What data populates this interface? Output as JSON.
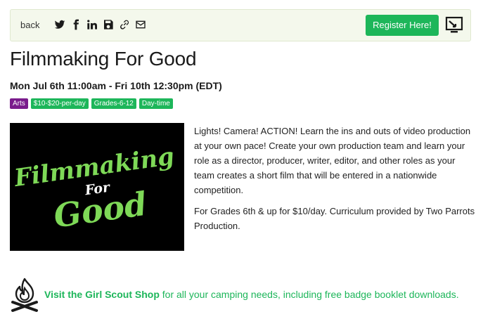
{
  "toolbar": {
    "back_label": "back",
    "share_icons": [
      "twitter-icon",
      "facebook-icon",
      "linkedin-icon",
      "save-icon",
      "link-icon",
      "email-icon"
    ],
    "register_label": "Register Here!"
  },
  "event": {
    "title": "Filmmaking For Good",
    "dates": "Mon Jul 6th 11:00am - Fri 10th 12:30pm (EDT)",
    "tags": [
      "Arts",
      "$10-$20-per-day",
      "Grades-6-12",
      "Day-time"
    ],
    "image_text": [
      "Filmmaking",
      "For",
      "Good"
    ],
    "description": [
      "Lights! Camera! ACTION! Learn the ins and outs of video production at your own pace! Create your own production team and learn your role as a director, producer, writer, editor, and other roles as your team creates a short film that will be entered in a nationwide competition.",
      "For Grades 6th & up for $10/day. Curriculum provided by Two Parrots Production."
    ]
  },
  "footer": {
    "link_text": "Visit the Girl Scout Shop",
    "rest_text": " for all your camping needs, including free badge booklet downloads."
  },
  "colors": {
    "accent_green": "#1db65a",
    "arts_purple": "#7a1b8c",
    "toolbar_bg": "#f4f8ec",
    "image_text_green": "#7ed957"
  }
}
